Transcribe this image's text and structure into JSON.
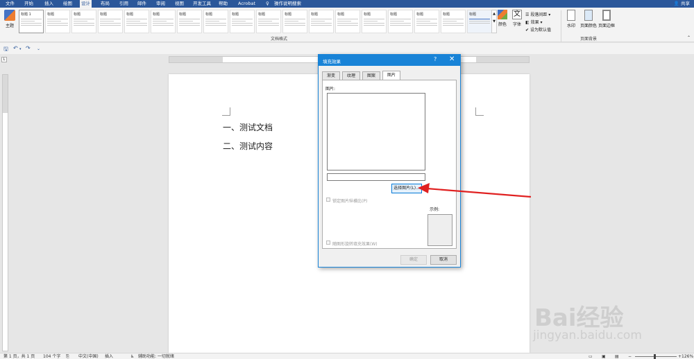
{
  "menubar": {
    "tabs": [
      "文件",
      "开始",
      "插入",
      "绘图",
      "设计",
      "布局",
      "引用",
      "邮件",
      "审阅",
      "视图",
      "开发工具",
      "帮助",
      "Acrobat"
    ],
    "active_tab": "设计",
    "search_label": "操作说明搜索",
    "share_label": "共享"
  },
  "ribbon": {
    "theme_label": "主题",
    "style_thumbs": [
      "标题 1",
      "标题",
      "标题",
      "标题",
      "标题",
      "标题",
      "标题",
      "标题",
      "标题",
      "标题",
      "标题",
      "标题",
      "标题",
      "标题",
      "标题",
      "标题",
      "标题",
      "标题"
    ],
    "group_doc_format": "文档格式",
    "colors_label": "颜色",
    "fonts_label": "字体",
    "para_spacing_label": "段落间距",
    "effects_label": "效果",
    "set_default_label": "设为默认值",
    "watermark_label": "水印",
    "page_color_label": "页面颜色",
    "page_border_label": "页面边框",
    "group_page_bg": "页面背景"
  },
  "document": {
    "lines": [
      "一、测试文档",
      "二、测试内容"
    ]
  },
  "dialog": {
    "title": "填充效果",
    "help": "?",
    "close": "✕",
    "tabs": [
      "渐变",
      "纹理",
      "图案",
      "图片"
    ],
    "active_tab": "图片",
    "picture_label": "图片:",
    "select_button": "选择图片(L)...",
    "lock_ratio_label": "锁定图片纵横比(P)",
    "sample_label": "示例:",
    "rotate_label": "随图形旋转填充效果(W)",
    "ok_label": "确定",
    "cancel_label": "取消"
  },
  "statusbar": {
    "page": "第 1 页，共 1 页",
    "words": "104 个字",
    "language": "中文(中国)",
    "mode": "插入",
    "accessibility": "辅助功能: 一切就绪",
    "zoom": "126%"
  },
  "watermark": {
    "logo": "Bai经验",
    "url": "jingyan.baidu.com"
  },
  "colors": {
    "accent": "#2b579a",
    "dialog_title": "#1883d7",
    "arrow": "#e02020"
  }
}
